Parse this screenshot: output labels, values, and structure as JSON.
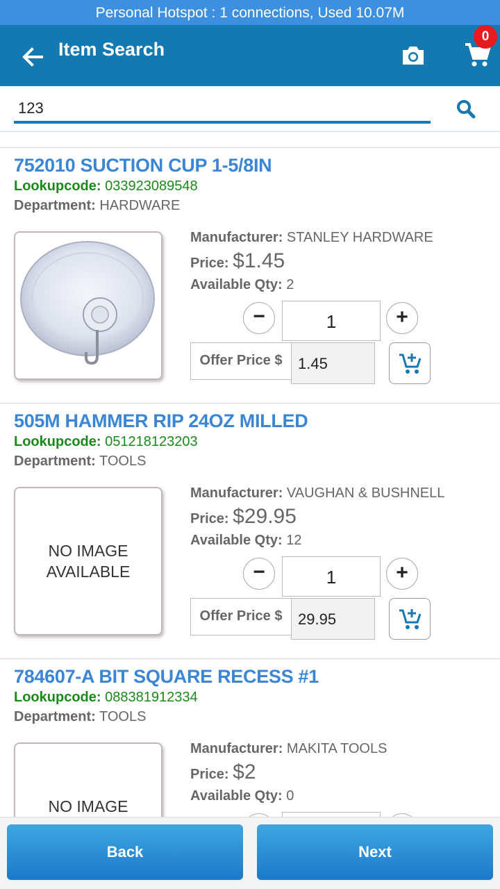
{
  "status_bar": {
    "text": "Personal Hotspot : 1 connections, Used 10.07M"
  },
  "app_bar": {
    "title": "Item Search",
    "cart_count": "0"
  },
  "search": {
    "value": "123"
  },
  "labels": {
    "lookupcode": "Lookupcode:",
    "department": "Department:",
    "manufacturer": "Manufacturer:",
    "price": "Price:",
    "available_qty": "Available Qty:",
    "offer_price": "Offer Price $",
    "no_image": "NO IMAGE\nAVAILABLE",
    "minus": "−",
    "plus": "+"
  },
  "items": [
    {
      "title": "752010 SUCTION CUP 1-5/8IN",
      "lookupcode": "033923089548",
      "department": "HARDWARE",
      "manufacturer": "STANLEY HARDWARE",
      "price": "$1.45",
      "available_qty": "2",
      "quantity": "1",
      "offer_price": "1.45",
      "has_image": true
    },
    {
      "title": "505M HAMMER RIP 24OZ MILLED",
      "lookupcode": "051218123203",
      "department": "TOOLS",
      "manufacturer": "VAUGHAN & BUSHNELL",
      "price": "$29.95",
      "available_qty": "12",
      "quantity": "1",
      "offer_price": "29.95",
      "has_image": false
    },
    {
      "title": "784607-A BIT SQUARE RECESS #1",
      "lookupcode": "088381912334",
      "department": "TOOLS",
      "manufacturer": "MAKITA TOOLS",
      "price": "$2",
      "available_qty": "0",
      "quantity": "",
      "offer_price": "",
      "has_image": false
    }
  ],
  "footer": {
    "back_label": "Back",
    "next_label": "Next"
  },
  "colors": {
    "status_bar": "#3d8fe0",
    "app_bar": "#1479b0",
    "title_link": "#3b86d4",
    "lookup_green": "#1a8a1a",
    "badge_red": "#e8191f"
  }
}
